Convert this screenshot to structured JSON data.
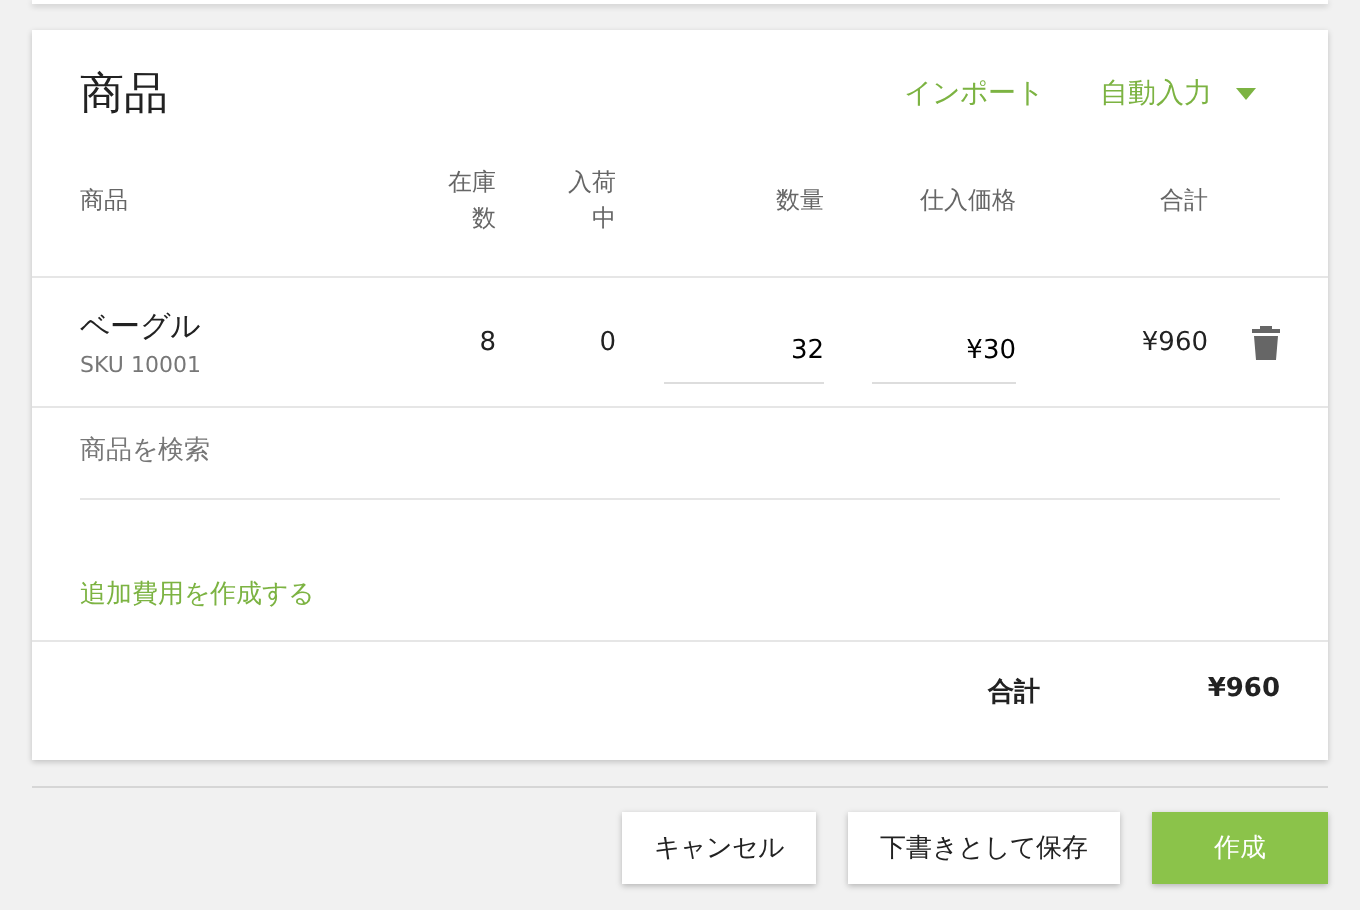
{
  "card": {
    "title": "商品",
    "actions": [
      {
        "kind": "link",
        "label": "インポート"
      },
      {
        "kind": "dropdown",
        "label": "自動入力"
      }
    ]
  },
  "table": {
    "columns": [
      "商品",
      "在庫数",
      "入荷中",
      "数量",
      "仕入価格",
      "合計"
    ],
    "rows": [
      {
        "name": "ベーグル",
        "sku": "SKU 10001",
        "stock": "8",
        "incoming": "0",
        "quantity": "32",
        "price": "¥30",
        "total": "¥960"
      }
    ]
  },
  "search": {
    "placeholder": "商品を検索"
  },
  "extra_cost_link": "追加費用を作成する",
  "summary": {
    "label": "合計",
    "value": "¥960"
  },
  "buttons": [
    {
      "label": "キャンセル",
      "kind": "secondary"
    },
    {
      "label": "下書きとして保存",
      "kind": "secondary"
    },
    {
      "label": "作成",
      "kind": "primary"
    }
  ]
}
